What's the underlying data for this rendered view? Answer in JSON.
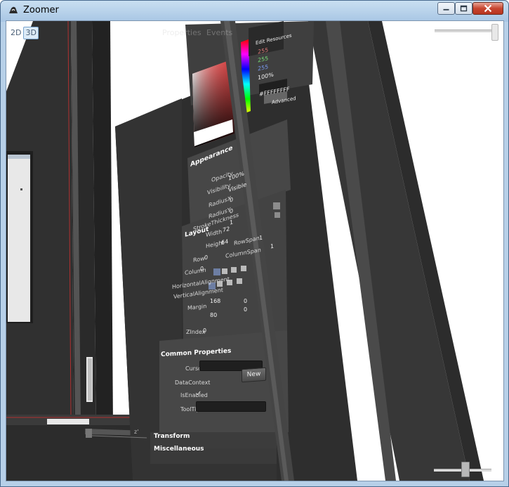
{
  "window": {
    "title": "Zoomer",
    "app_icon": "zoomer-app-icon",
    "controls": [
      "minimize-icon",
      "maximize-icon",
      "close-icon"
    ]
  },
  "view_mode": {
    "options": [
      "2D",
      "3D"
    ],
    "selected": "3D"
  },
  "zoom_level": 0.55,
  "background_tabs": {
    "properties": "Properties",
    "events": "Events"
  },
  "color_editor": {
    "channels": [
      "255",
      "255",
      "255",
      "100%"
    ],
    "hex_value": "#FFFFFFFF",
    "fragment_cut": "Edit Resources",
    "advanced_label": "Advanced"
  },
  "appearance": {
    "header": "Appearance",
    "labels": {
      "opacity": "Opacity",
      "visibility": "Visibility",
      "radius_x": "RadiusX",
      "radius_y": "RadiusY",
      "stroke_thickness": "StrokeThickness"
    },
    "values": {
      "opacity": "100%",
      "visibility": "Visible",
      "radius_x": "0",
      "radius_y": "0",
      "stroke_thickness": "1"
    }
  },
  "layout": {
    "header": "Layout",
    "labels": {
      "width": "Width",
      "height": "Height",
      "row": "Row",
      "row_span": "RowSpan",
      "column": "Column",
      "column_span": "ColumnSpan",
      "horizontal_alignment": "HorizontalAlignment",
      "vertical_alignment": "VerticalAlignment",
      "margin": "Margin",
      "zindex": "ZIndex"
    },
    "values": {
      "width": "72",
      "height": "64",
      "row": "0",
      "row_span": "1",
      "column": "0",
      "column_span": "1",
      "margin_left": "168",
      "margin_right": "0",
      "margin_top": "80",
      "margin_bottom": "0",
      "zindex": "0"
    }
  },
  "common_properties": {
    "header": "Common Properties",
    "labels": {
      "cursor": "Cursor",
      "data_context": "DataContext",
      "is_enabled": "IsEnabled",
      "tooltip": "ToolTip"
    },
    "new_button": "New",
    "is_enabled_checked": true
  },
  "collapsed_sections": {
    "transform": "Transform",
    "miscellaneous": "Miscellaneous"
  },
  "corner_label": "z'"
}
